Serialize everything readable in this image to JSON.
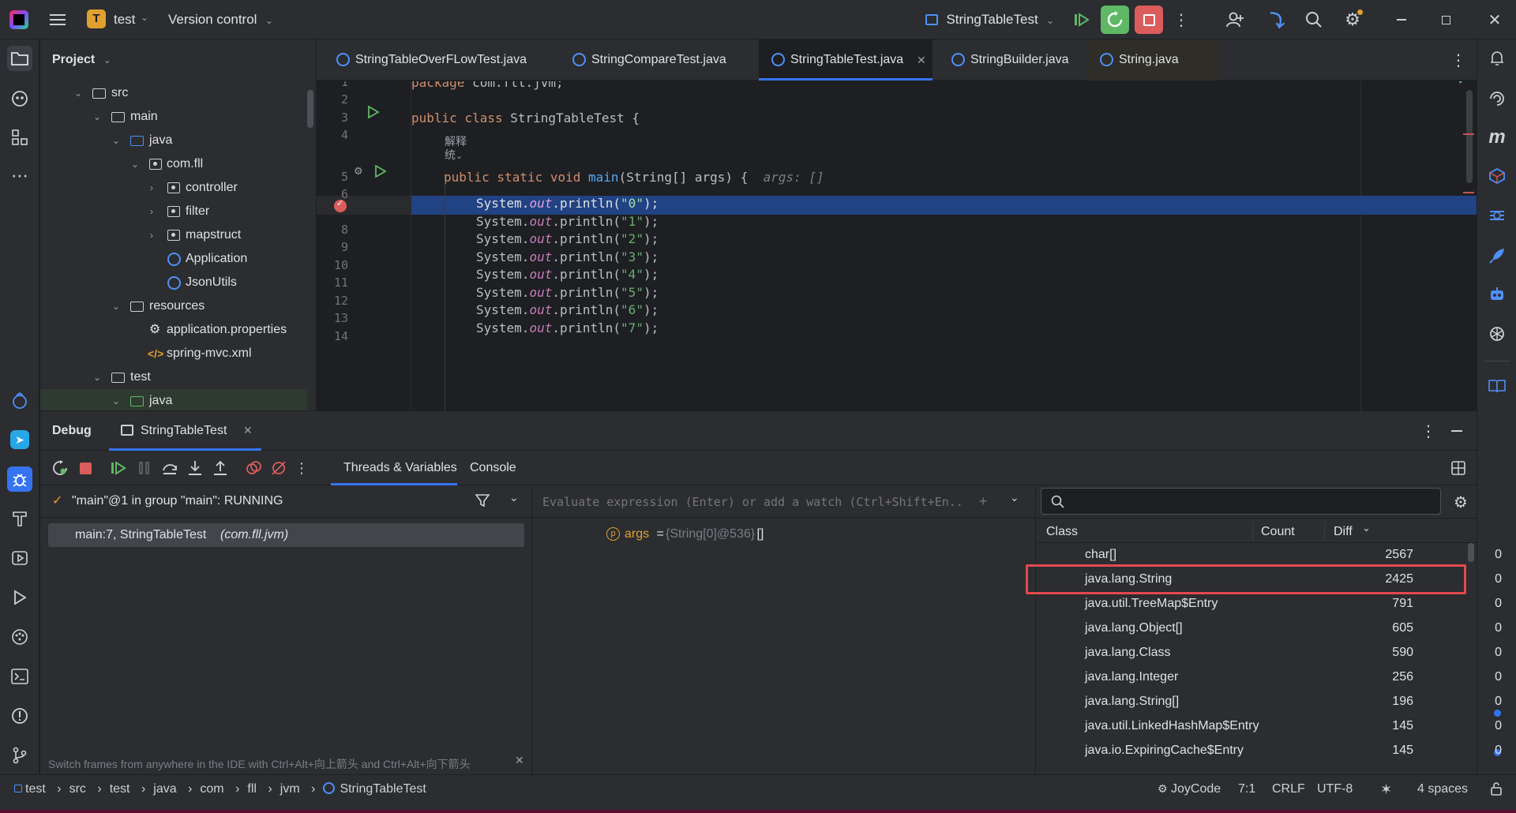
{
  "titlebar": {
    "project_badge": "T",
    "project_name": "test",
    "vcs": "Version control",
    "run_config": "StringTableTest"
  },
  "project_panel": {
    "title": "Project",
    "tree": [
      {
        "label": "src",
        "type": "folder",
        "expanded": true
      },
      {
        "label": "main",
        "type": "folder",
        "expanded": true
      },
      {
        "label": "java",
        "type": "source-folder",
        "expanded": true
      },
      {
        "label": "com.fll",
        "type": "package",
        "expanded": true
      },
      {
        "label": "controller",
        "type": "package",
        "expanded": false
      },
      {
        "label": "filter",
        "type": "package",
        "expanded": false
      },
      {
        "label": "mapstruct",
        "type": "package",
        "expanded": false
      },
      {
        "label": "Application",
        "type": "class"
      },
      {
        "label": "JsonUtils",
        "type": "class"
      },
      {
        "label": "resources",
        "type": "resources-folder",
        "expanded": true
      },
      {
        "label": "application.properties",
        "type": "properties"
      },
      {
        "label": "spring-mvc.xml",
        "type": "xml"
      },
      {
        "label": "test",
        "type": "folder",
        "expanded": true
      },
      {
        "label": "java",
        "type": "test-source-folder",
        "expanded": true
      }
    ]
  },
  "editor_tabs": [
    {
      "label": "StringTableOverFLowTest.java",
      "active": false
    },
    {
      "label": "StringCompareTest.java",
      "active": false
    },
    {
      "label": "StringTableTest.java",
      "active": true
    },
    {
      "label": "StringBuilder.java",
      "active": false
    },
    {
      "label": "String.java",
      "active": false
    }
  ],
  "editor": {
    "line_numbers": [
      "1",
      "2",
      "3",
      "4",
      "5",
      "6",
      "7",
      "8",
      "9",
      "10",
      "11",
      "12",
      "13",
      "14"
    ],
    "code": {
      "l1_kw": "package",
      "l1_rest": " com.fll.jvm;",
      "l3_kw": "public class",
      "l3_rest": " StringTableTest {",
      "inlay_1": "解释",
      "inlay_2": "统",
      "l5_kw": "public static void",
      "l5_fn": "main",
      "l5_rest": "(String[] args) {",
      "l5_hint": "args: []",
      "println_lines": [
        {
          "pre": "System.",
          "field": "out",
          "mid": ".println(",
          "str": "\"0\"",
          "post": ");"
        },
        {
          "pre": "System.",
          "field": "out",
          "mid": ".println(",
          "str": "\"1\"",
          "post": ");"
        },
        {
          "pre": "System.",
          "field": "out",
          "mid": ".println(",
          "str": "\"2\"",
          "post": ");"
        },
        {
          "pre": "System.",
          "field": "out",
          "mid": ".println(",
          "str": "\"3\"",
          "post": ");"
        },
        {
          "pre": "System.",
          "field": "out",
          "mid": ".println(",
          "str": "\"4\"",
          "post": ");"
        },
        {
          "pre": "System.",
          "field": "out",
          "mid": ".println(",
          "str": "\"5\"",
          "post": ");"
        },
        {
          "pre": "System.",
          "field": "out",
          "mid": ".println(",
          "str": "\"6\"",
          "post": ");"
        },
        {
          "pre": "System.",
          "field": "out",
          "mid": ".println(",
          "str": "\"7\"",
          "post": ");"
        }
      ]
    }
  },
  "debug": {
    "title": "Debug",
    "session_tab": "StringTableTest",
    "tabs": [
      "Threads & Variables",
      "Console"
    ],
    "thread": "\"main\"@1 in group \"main\": RUNNING",
    "frame": "main:7, StringTableTest",
    "frame_pkg": "(com.fll.jvm)",
    "eval_placeholder": "Evaluate expression (Enter) or add a watch (Ctrl+Shift+En..",
    "var_name": "args",
    "var_eq": " = ",
    "var_type": "{String[0]@536}",
    "var_value": " []",
    "hint": "Switch frames from anywhere in the IDE with Ctrl+Alt+向上箭头 and Ctrl+Alt+向下箭头",
    "memory": {
      "columns": [
        "Class",
        "Count",
        "Diff"
      ],
      "rows": [
        {
          "cls": "char[]",
          "count": "2567",
          "diff": "0"
        },
        {
          "cls": "java.lang.String",
          "count": "2425",
          "diff": "0",
          "highlighted": true
        },
        {
          "cls": "java.util.TreeMap$Entry",
          "count": "791",
          "diff": "0"
        },
        {
          "cls": "java.lang.Object[]",
          "count": "605",
          "diff": "0"
        },
        {
          "cls": "java.lang.Class",
          "count": "590",
          "diff": "0"
        },
        {
          "cls": "java.lang.Integer",
          "count": "256",
          "diff": "0"
        },
        {
          "cls": "java.lang.String[]",
          "count": "196",
          "diff": "0"
        },
        {
          "cls": "java.util.LinkedHashMap$Entry",
          "count": "145",
          "diff": "0"
        },
        {
          "cls": "java.io.ExpiringCache$Entry",
          "count": "145",
          "diff": "0"
        }
      ]
    }
  },
  "statusbar": {
    "breadcrumb": [
      "test",
      "src",
      "test",
      "java",
      "com",
      "fll",
      "jvm",
      "StringTableTest"
    ],
    "plugin": "JoyCode",
    "position": "7:1",
    "line_sep": "CRLF",
    "encoding": "UTF-8",
    "indent": "4 spaces"
  },
  "colors": {
    "accent": "#3574f0",
    "highlight_line": "#214283",
    "breakpoint": "#db5c5c",
    "red_box": "#e5484d"
  }
}
